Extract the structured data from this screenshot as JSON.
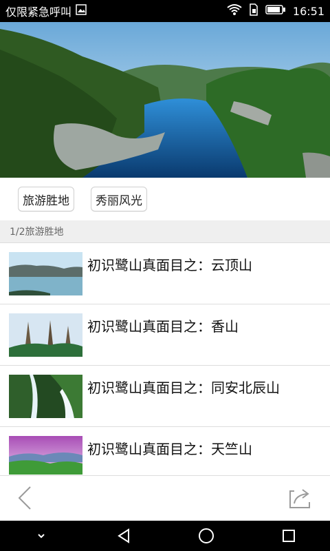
{
  "status_bar": {
    "left_text": "仅限紧急呼叫",
    "time": "16:51",
    "icons": [
      "photo-icon",
      "wifi-icon",
      "sim-icon",
      "battery-icon"
    ]
  },
  "tabs": [
    {
      "label": "旅游胜地"
    },
    {
      "label": "秀丽风光"
    }
  ],
  "section_header": {
    "text": "1/2旅游胜地"
  },
  "list": {
    "items": [
      {
        "title": "初识鹭山真面目之：云顶山"
      },
      {
        "title": "初识鹭山真面目之：香山"
      },
      {
        "title": "初识鹭山真面目之：同安北辰山"
      },
      {
        "title": "初识鹭山真面目之：天竺山"
      }
    ]
  },
  "bottom_bar": {
    "icons": [
      "back-arrow-icon",
      "share-icon"
    ]
  },
  "system_nav": {
    "icons": [
      "chevron-down-icon",
      "back-triangle-icon",
      "home-circle-icon",
      "recent-square-icon"
    ]
  }
}
